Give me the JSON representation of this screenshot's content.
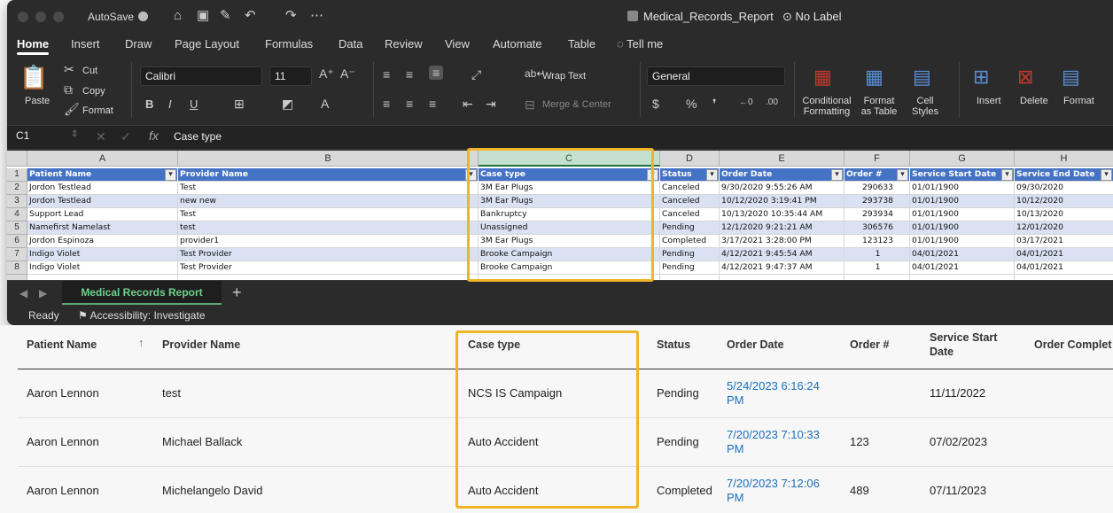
{
  "window": {
    "autosave_label": "AutoSave",
    "doc_title": "Medical_Records_Report",
    "label_status": "No Label"
  },
  "tabs": [
    "Home",
    "Insert",
    "Draw",
    "Page Layout",
    "Formulas",
    "Data",
    "Review",
    "View",
    "Automate",
    "Table",
    "Tell me"
  ],
  "ribbon": {
    "paste": "Paste",
    "cut": "Cut",
    "copy": "Copy",
    "format_painter": "Format",
    "font_name": "Calibri",
    "font_size": "11",
    "wrap_text": "Wrap Text",
    "merge_center": "Merge & Center",
    "number_format": "General",
    "conditional_formatting": "Conditional Formatting",
    "format_as_table": "Format as Table",
    "cell_styles": "Cell Styles",
    "insert": "Insert",
    "delete": "Delete",
    "format": "Format"
  },
  "formula_bar": {
    "cell_ref": "C1",
    "content": "Case type"
  },
  "sheet": {
    "columns": [
      "A",
      "B",
      "C",
      "D",
      "E",
      "F",
      "G",
      "H"
    ],
    "rows": [
      "1",
      "2",
      "3",
      "4",
      "5",
      "6",
      "7",
      "8"
    ],
    "headers": [
      "Patient Name",
      "Provider Name",
      "Case type",
      "Status",
      "Order Date",
      "Order #",
      "Service Start Date",
      "Service End Date"
    ],
    "data": [
      [
        "Jordon Testlead",
        "Test",
        "3M Ear Plugs",
        "Canceled",
        "9/30/2020 9:55:26 AM",
        "290633",
        "01/01/1900",
        "09/30/2020"
      ],
      [
        "Jordon Testlead",
        "new new",
        "3M Ear Plugs",
        "Canceled",
        "10/12/2020 3:19:41 PM",
        "293738",
        "01/01/1900",
        "10/12/2020"
      ],
      [
        "Support Lead",
        "Test",
        "Bankruptcy",
        "Canceled",
        "10/13/2020 10:35:44 AM",
        "293934",
        "01/01/1900",
        "10/13/2020"
      ],
      [
        "Namefirst Namelast",
        "test",
        "Unassigned",
        "Pending",
        "12/1/2020 9:21:21 AM",
        "306576",
        "01/01/1900",
        "12/01/2020"
      ],
      [
        "Jordon Espinoza",
        "provider1",
        "3M Ear Plugs",
        "Completed",
        "3/17/2021 3:28:00 PM",
        "123123",
        "01/01/1900",
        "03/17/2021"
      ],
      [
        "Indigo Violet",
        "Test Provider",
        "Brooke Campaign",
        "Pending",
        "4/12/2021 9:45:54 AM",
        "1",
        "04/01/2021",
        "04/01/2021"
      ],
      [
        "Indigo Violet",
        "Test Provider",
        "Brooke Campaign",
        "Pending",
        "4/12/2021 9:47:37 AM",
        "1",
        "04/01/2021",
        "04/01/2021"
      ]
    ],
    "sheet_tab": "Medical Records Report"
  },
  "statusbar": {
    "ready": "Ready",
    "accessibility": "Accessibility: Investigate"
  },
  "web_table": {
    "headers": {
      "patient": "Patient Name",
      "provider": "Provider Name",
      "case_type": "Case type",
      "status": "Status",
      "order_date": "Order Date",
      "order_no": "Order #",
      "service_start": "Service Start Date",
      "order_complete": "Order Complet"
    },
    "rows": [
      {
        "patient": "Aaron Lennon",
        "provider": "test",
        "case_type": "NCS IS Campaign",
        "status": "Pending",
        "order_date": "5/24/2023 6:16:24 PM",
        "order_no": "",
        "service_start": "11/11/2022"
      },
      {
        "patient": "Aaron Lennon",
        "provider": "Michael Ballack",
        "case_type": "Auto Accident",
        "status": "Pending",
        "order_date": "7/20/2023 7:10:33 PM",
        "order_no": "123",
        "service_start": "07/02/2023"
      },
      {
        "patient": "Aaron Lennon",
        "provider": "Michelangelo David",
        "case_type": "Auto Accident",
        "status": "Completed",
        "order_date": "7/20/2023 7:12:06 PM",
        "order_no": "489",
        "service_start": "07/11/2023"
      }
    ]
  },
  "colors": {
    "highlight": "#f0b429",
    "table_header": "#4472c4",
    "band": "#d9e1f2",
    "link": "#1a6ebd",
    "sheet_tab": "#6fd08a"
  }
}
